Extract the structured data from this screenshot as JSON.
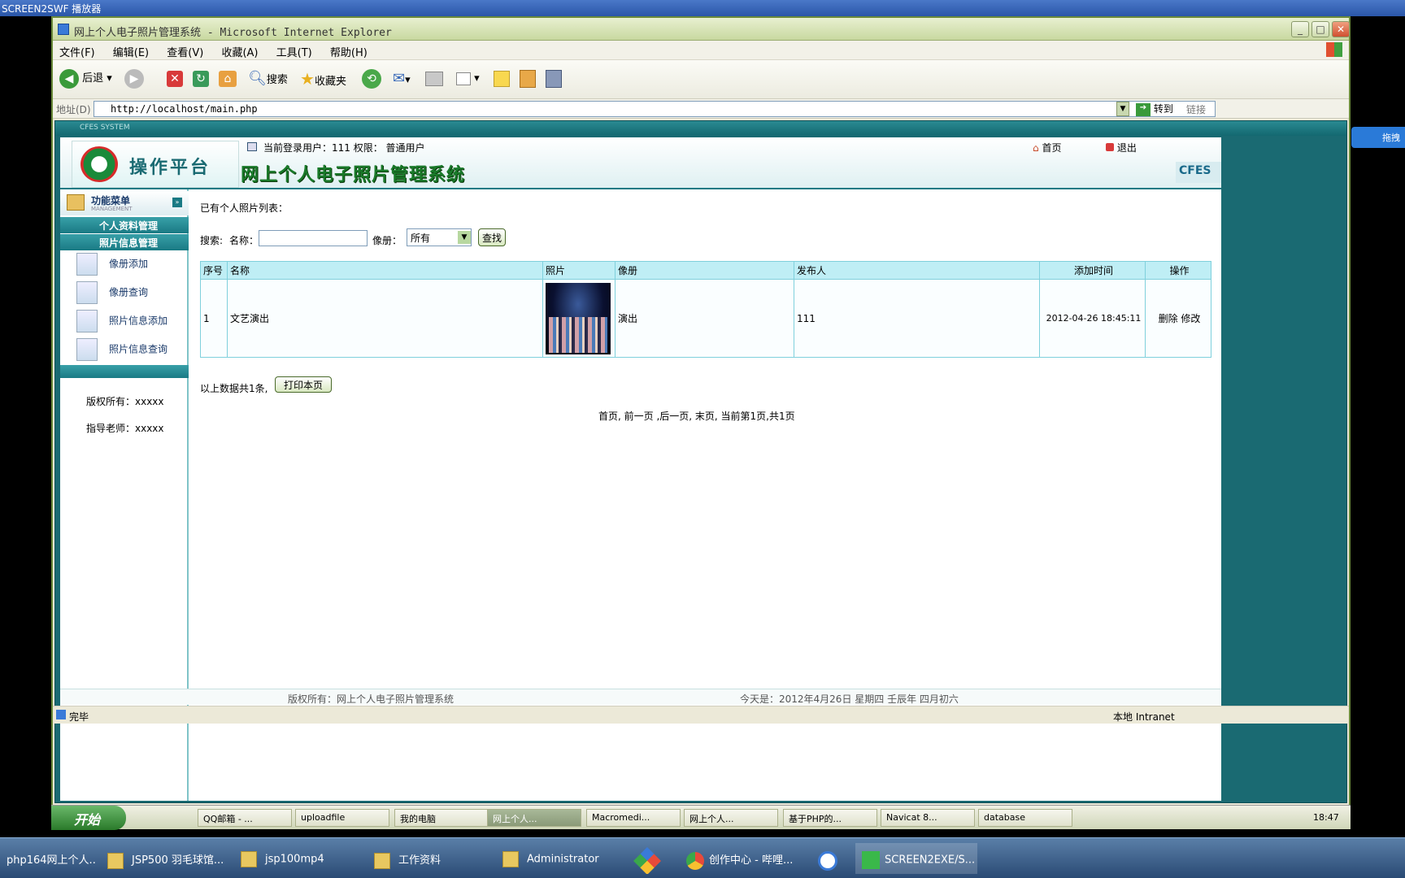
{
  "player": {
    "title": "SCREEN2SWF 播放器"
  },
  "ie": {
    "title": "网上个人电子照片管理系统 - Microsoft Internet Explorer",
    "menus": [
      "文件(F)",
      "编辑(E)",
      "查看(V)",
      "收藏(A)",
      "工具(T)",
      "帮助(H)"
    ],
    "toolbar": {
      "back": "后退",
      "search": "搜索",
      "favorites": "收藏夹"
    },
    "address_label": "地址(D)",
    "address_value": "http://localhost/main.php",
    "go_label": "转到",
    "links_label": "链接",
    "status": "完毕",
    "zone": "本地 Intranet"
  },
  "page": {
    "system_tag": "CFES SYSTEM",
    "logo_text": "操作平台",
    "system_title": "网上个人电子照片管理系统",
    "user_info": "当前登录用户：111 权限： 普通用户",
    "home_link": "首页",
    "logout_link": "退出",
    "brand": "CFES",
    "sidebar": {
      "menu_title": "功能菜单",
      "menu_sub": "MANAGEMENT",
      "sections": [
        "个人资料管理",
        "照片信息管理"
      ],
      "items": [
        "像册添加",
        "像册查询",
        "照片信息添加",
        "照片信息查询"
      ],
      "copyright": "版权所有：xxxxx",
      "teacher": "指导老师：xxxxx"
    },
    "main": {
      "heading": "已有个人照片列表：",
      "search_label": "搜索:",
      "name_label": "名称：",
      "album_label": "像册：",
      "album_selected": "所有",
      "find_button": "查找",
      "columns": [
        "序号",
        "名称",
        "照片",
        "像册",
        "发布人",
        "添加时间",
        "操作"
      ],
      "rows": [
        {
          "no": "1",
          "name": "文艺演出",
          "album": "演出",
          "publisher": "111",
          "time": "2012-04-26 18:45:11",
          "delete": "删除",
          "edit": "修改"
        }
      ],
      "total_text": "以上数据共1条,",
      "print_button": "打印本页",
      "pagination": "首页, 前一页 ,后一页, 末页, 当前第1页,共1页"
    },
    "footer_copyright": "版权所有：网上个人电子照片管理系统",
    "footer_date": "今天是：2012年4月26日 星期四 壬辰年 四月初六"
  },
  "xp_taskbar": {
    "start": "开始",
    "items": [
      "QQ邮箱 - ...",
      "uploadfile",
      "我的电脑",
      "网上个人...",
      "Macromedi...",
      "网上个人...",
      "基于PHP的...",
      "Navicat 8...",
      "database"
    ],
    "clock": "18:47"
  },
  "w7_taskbar": {
    "items": [
      "php164网上个人...",
      "JSP500 羽毛球馆...",
      "jsp100mp4",
      "工作资料",
      "Administrator",
      "创作中心 - 哔哩...",
      "SCREEN2EXE/S..."
    ]
  },
  "side_widget": "拖拽"
}
